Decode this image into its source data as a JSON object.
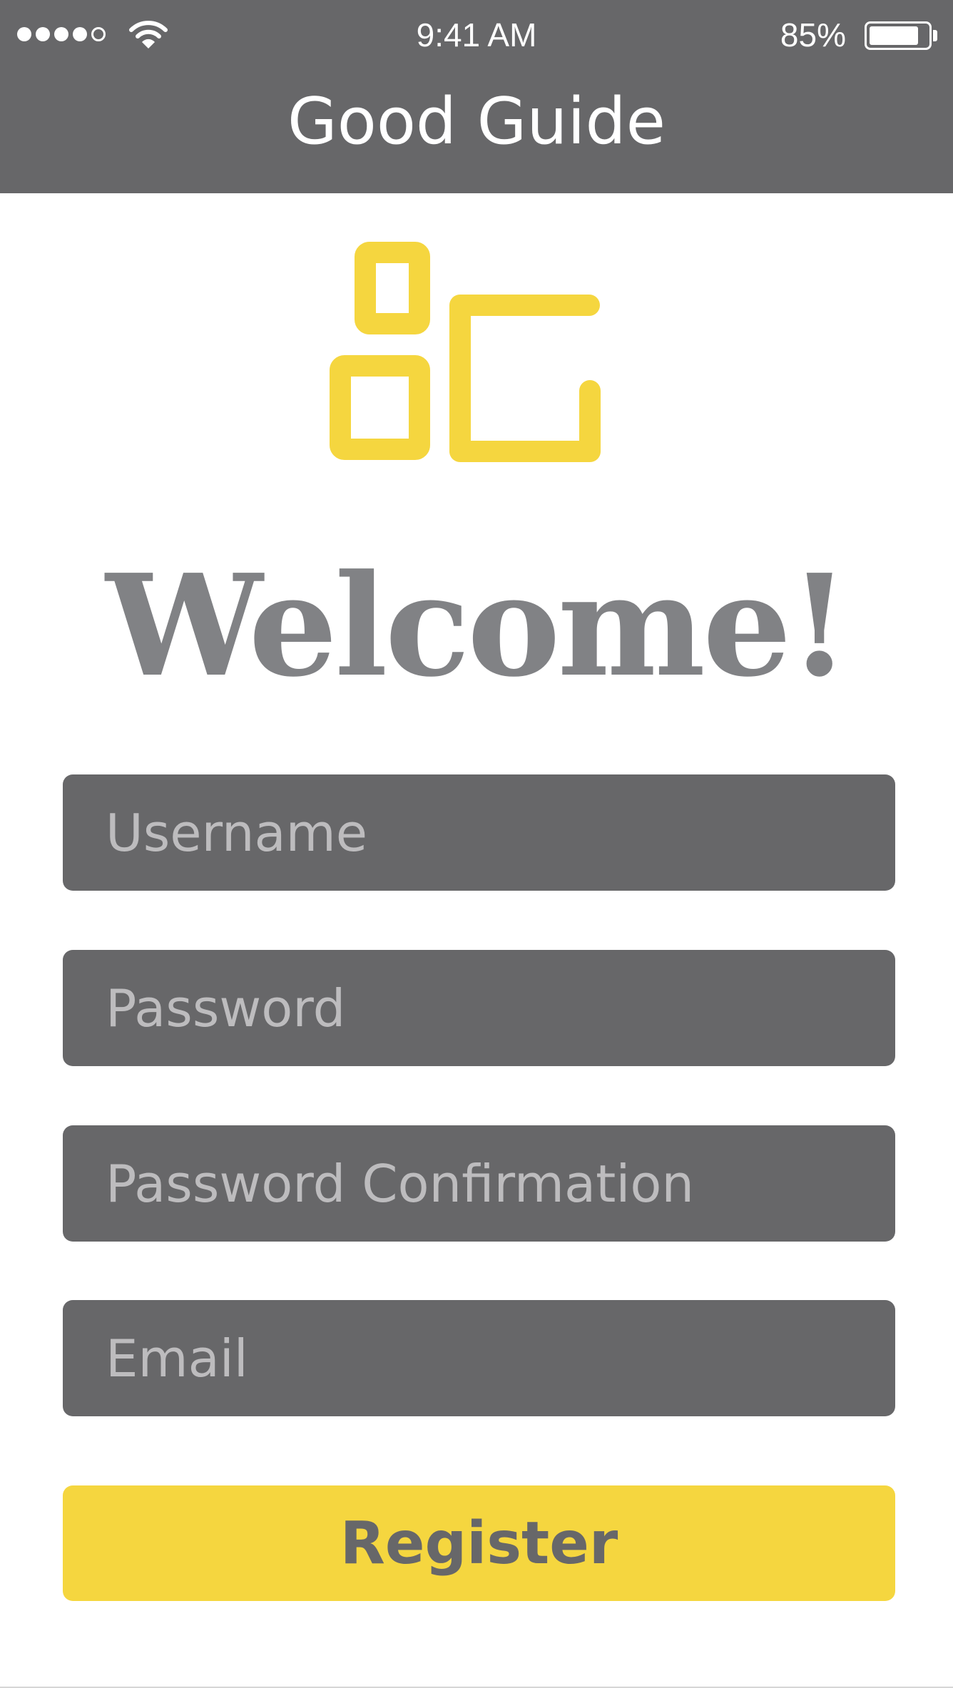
{
  "status_bar": {
    "time": "9:41 AM",
    "battery_percent": "85%",
    "battery_level": 0.85,
    "signal_bars_filled": 4,
    "signal_bars_total": 5
  },
  "header": {
    "title": "Good Guide"
  },
  "logo": {
    "icon": "good-guide-logo",
    "color": "#f5d63f"
  },
  "welcome": {
    "heading": "Welcome!"
  },
  "form": {
    "username_placeholder": "Username",
    "password_placeholder": "Password",
    "password_confirmation_placeholder": "Password Confirmation",
    "email_placeholder": "Email",
    "register_label": "Register"
  },
  "colors": {
    "header_bg": "#676769",
    "field_bg": "#676769",
    "placeholder": "#bdbcbe",
    "heading": "#818285",
    "accent": "#f5d63f"
  }
}
